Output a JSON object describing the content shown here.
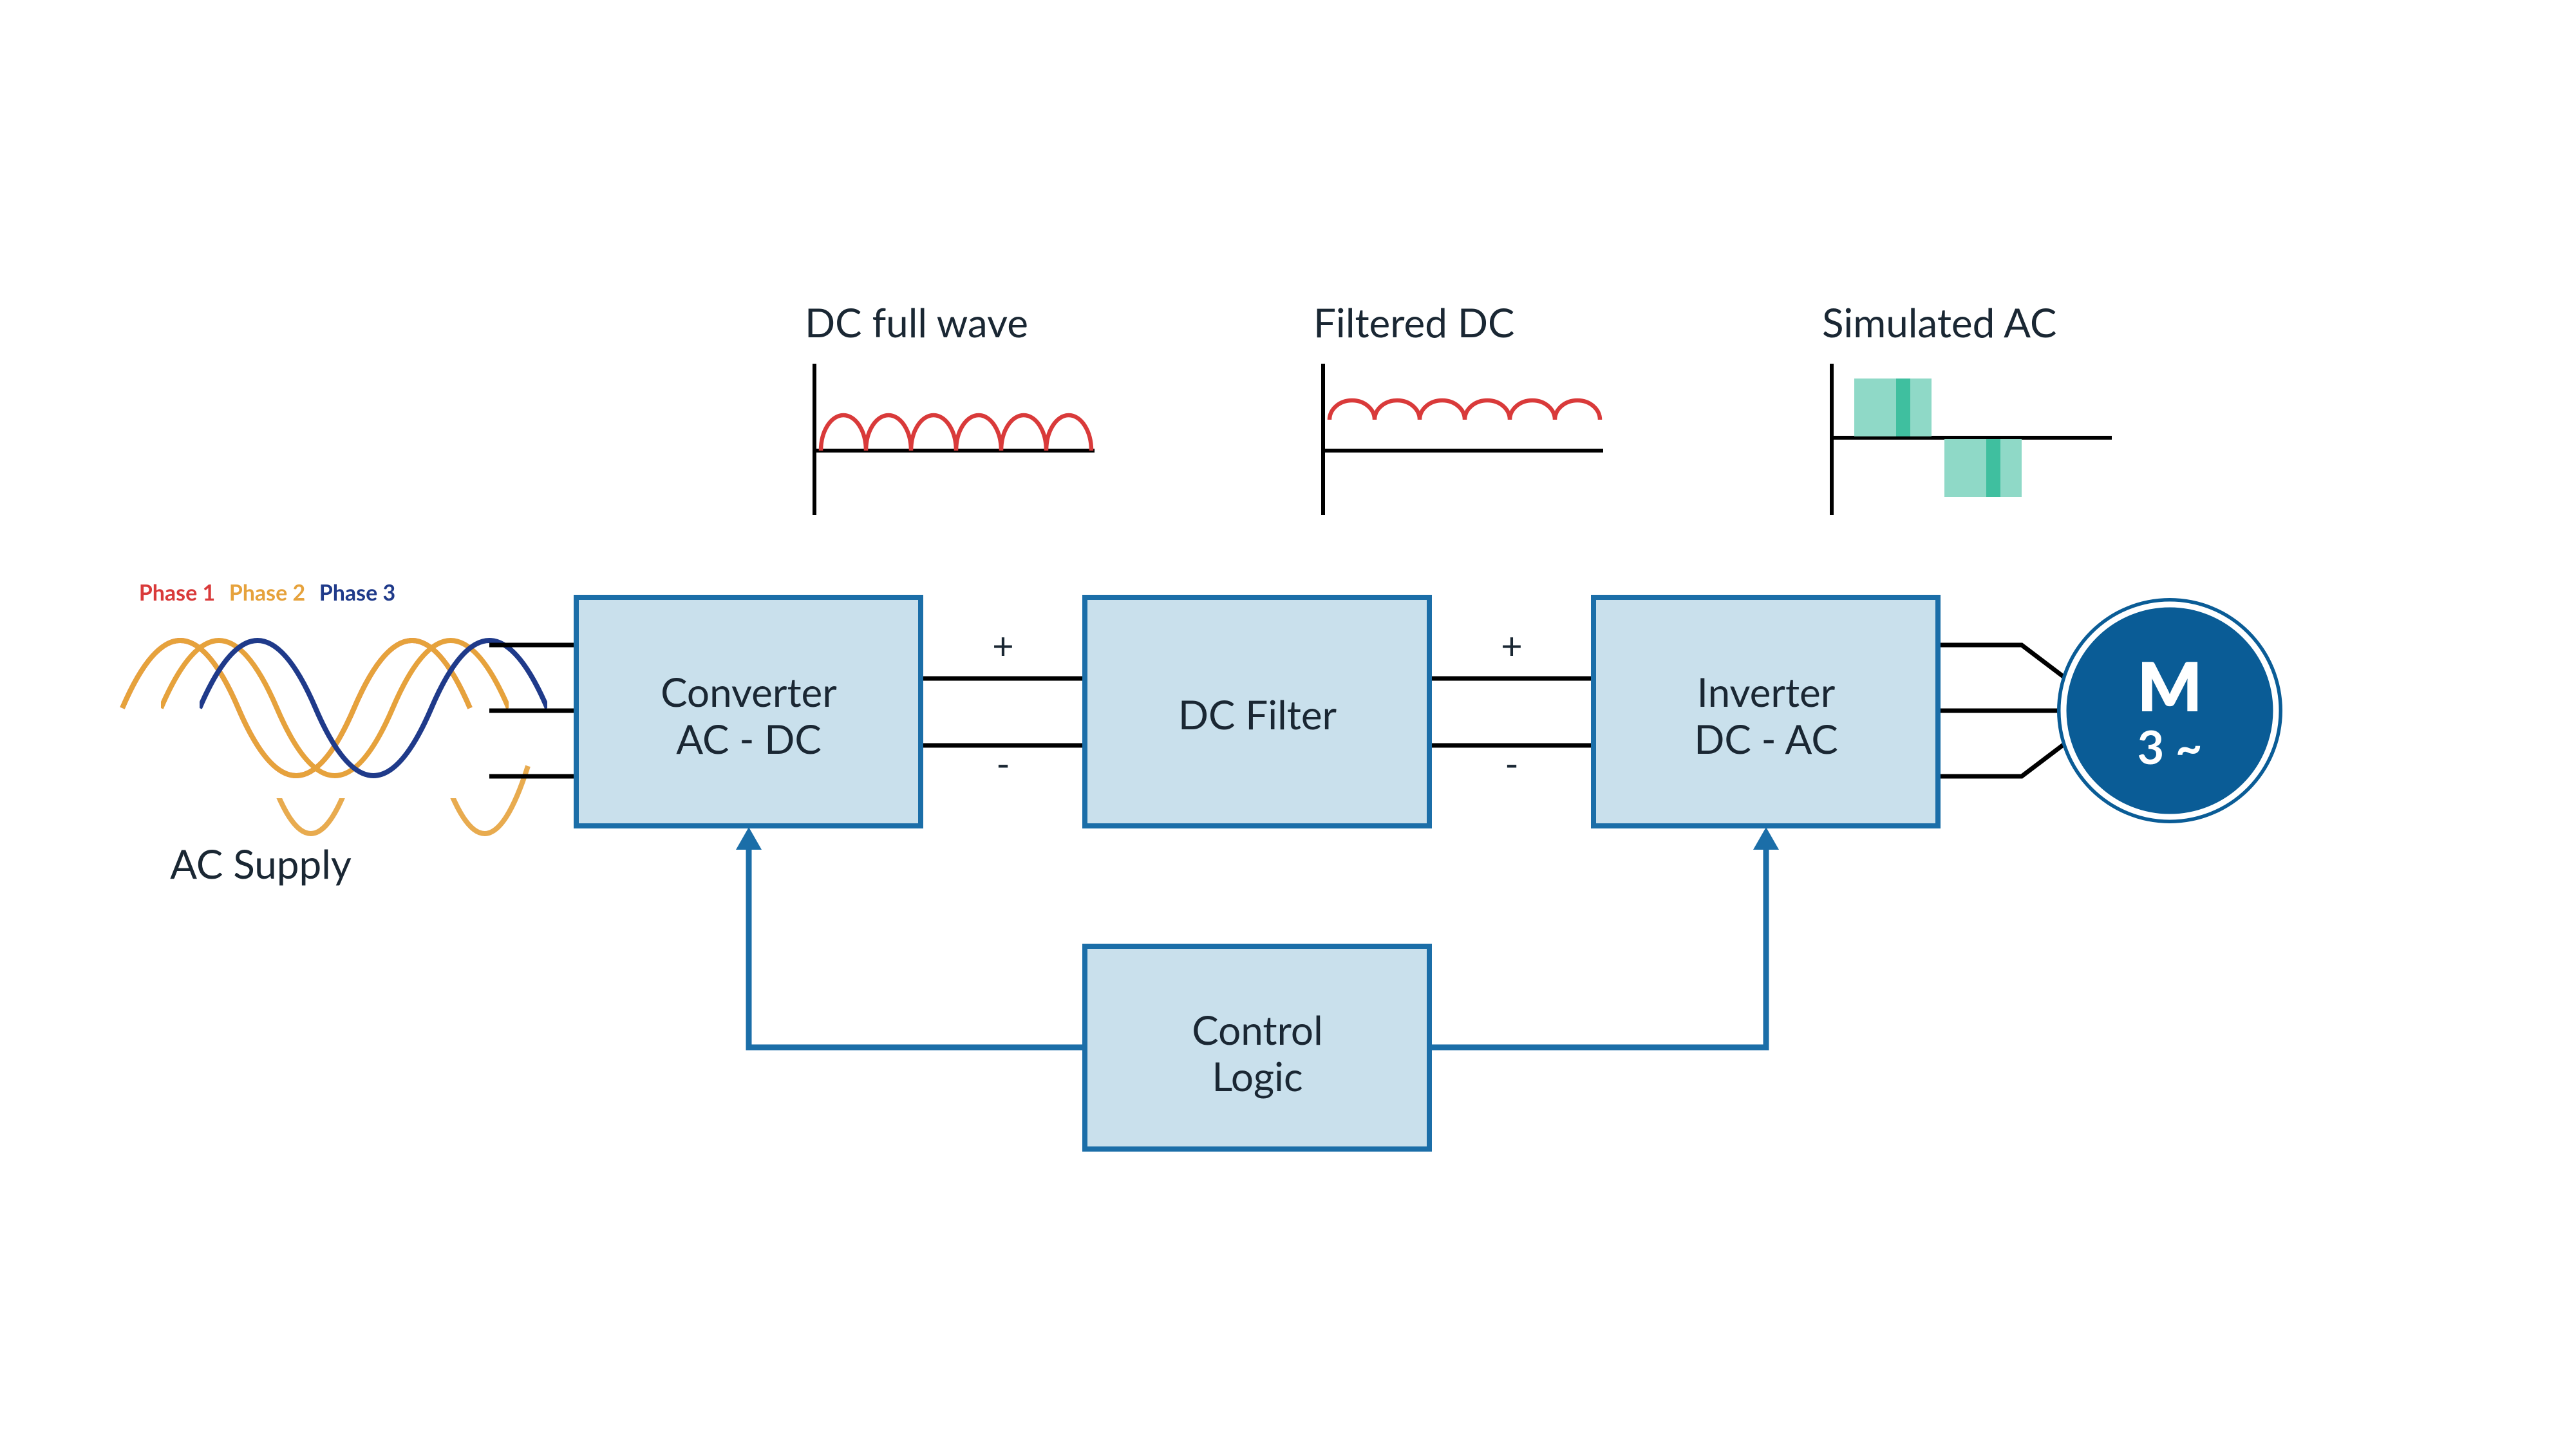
{
  "waveforms": {
    "dc_full_wave": "DC full wave",
    "filtered_dc": "Filtered DC",
    "simulated_ac": "Simulated AC"
  },
  "phases": {
    "p1": "Phase 1",
    "p2": "Phase 2",
    "p3": "Phase 3"
  },
  "labels": {
    "ac_supply": "AC Supply",
    "converter_l1": "Converter",
    "converter_l2": "AC - DC",
    "dc_filter": "DC Filter",
    "inverter_l1": "Inverter",
    "inverter_l2": "DC - AC",
    "control_l1": "Control",
    "control_l2": "Logic"
  },
  "signs": {
    "plus": "+",
    "minus": "-"
  },
  "motor": {
    "m": "M",
    "sub": "3 ~"
  }
}
